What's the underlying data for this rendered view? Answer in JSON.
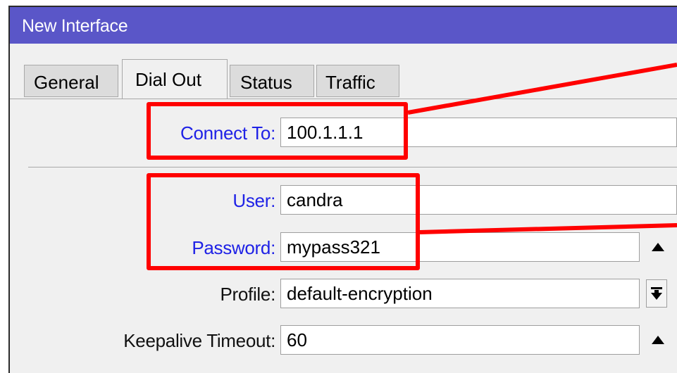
{
  "window": {
    "title": "New Interface"
  },
  "tabs": [
    {
      "label": "General",
      "active": false
    },
    {
      "label": "Dial Out",
      "active": true
    },
    {
      "label": "Status",
      "active": false
    },
    {
      "label": "Traffic",
      "active": false
    }
  ],
  "fields": {
    "connect_to": {
      "label": "Connect To:",
      "value": "100.1.1.1"
    },
    "user": {
      "label": "User:",
      "value": "candra"
    },
    "password": {
      "label": "Password:",
      "value": "mypass321"
    },
    "profile": {
      "label": "Profile:",
      "value": "default-encryption"
    },
    "keepalive_timeout": {
      "label": "Keepalive Timeout:",
      "value": "60"
    }
  },
  "colors": {
    "titlebar": "#5a56c8",
    "label_link": "#1f22e6",
    "annotation": "#ff0000"
  },
  "icons": {
    "collapse": "triangle-up-icon",
    "dropdown": "dropdown-arrow-icon"
  }
}
